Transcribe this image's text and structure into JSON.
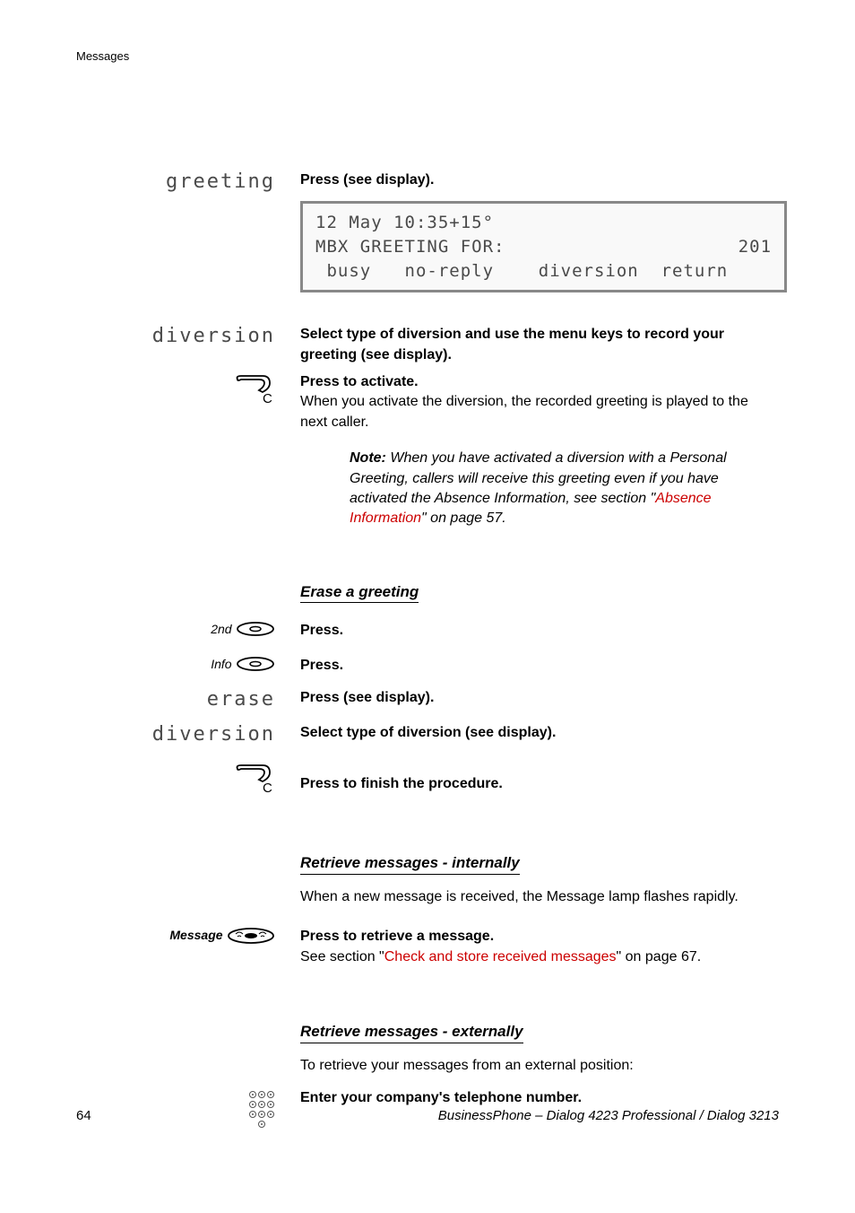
{
  "header": {
    "section": "Messages"
  },
  "s1": {
    "left_label": "greeting",
    "instruction": "Press (see display).",
    "lcd": {
      "r1_left": "12 May 10:35",
      "r1_right": "+15°",
      "r2_left": "MBX GREETING FOR:",
      "r2_right": "201",
      "r3": " busy   no-reply    diversion  return"
    }
  },
  "s2": {
    "left_label": "diversion",
    "title": "Select type of diversion and use the menu keys to record your greeting (see display).",
    "activate_title": "Press to activate.",
    "activate_body": "When you activate the diversion, the recorded greeting is played to the next caller.",
    "note_prefix": "Note:",
    "note_body": " When you have activated a diversion with a Personal Greeting, callers will receive this greeting even if you have activated the Absence Information, see section \"",
    "note_link": "Absence Information",
    "note_after": "\" on page 57."
  },
  "erase": {
    "title": "Erase a greeting",
    "l2nd": "2nd",
    "linfo": "Info",
    "press": "Press.",
    "erase_label": "erase",
    "erase_instr": "Press (see display).",
    "div_label": "diversion",
    "div_instr": "Select type of diversion (see display).",
    "finish": "Press to finish the procedure."
  },
  "retrieve_int": {
    "title": "Retrieve messages - internally",
    "body": "When a new message is received, the Message lamp flashes rapidly.",
    "msg_label": "Message",
    "instr": "Press to retrieve a message.",
    "see_before": "See section \"",
    "see_link": "Check and store received messages",
    "see_after": "\" on page 67."
  },
  "retrieve_ext": {
    "title": "Retrieve messages - externally",
    "body": "To retrieve your messages from an external position:",
    "instr": "Enter your company's telephone number."
  },
  "footer": {
    "page": "64",
    "product": "BusinessPhone – Dialog 4223 Professional / Dialog 3213"
  }
}
